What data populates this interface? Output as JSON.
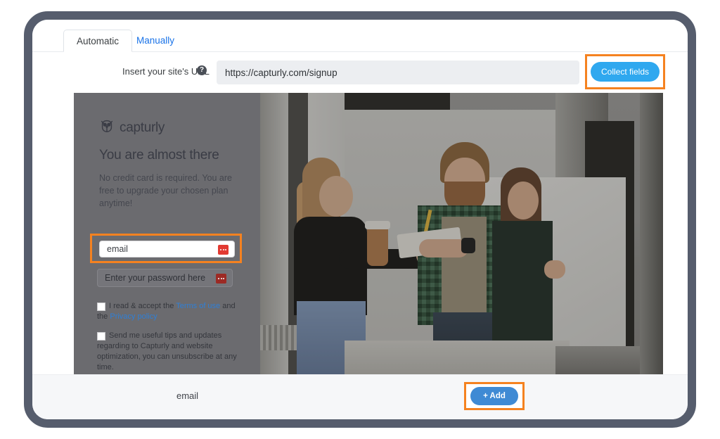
{
  "tabs": [
    {
      "label": "Automatic",
      "active": true
    },
    {
      "label": "Manually",
      "active": false
    }
  ],
  "url_row": {
    "label": "Insert your site's URL",
    "help_icon": "question-mark-icon",
    "url_value": "https://capturly.com/signup",
    "url_placeholder": "https://",
    "collect_button": "Collect fields"
  },
  "preview": {
    "brand": {
      "icon": "owl-icon",
      "name": "capturly"
    },
    "headline": "You are almost there",
    "subtext": "No credit card is required. You are free to upgrade your chosen plan anytime!",
    "email_field": {
      "value": "email",
      "badge_icon": "ellipsis-icon"
    },
    "password_field": {
      "value": "Enter your password here",
      "badge_icon": "ellipsis-icon"
    },
    "checkboxes": [
      {
        "text_before": "I read & accept the ",
        "link1": "Terms of use",
        "text_middle": " and the ",
        "link2": "Privacy policy",
        "text_after": ""
      },
      {
        "text_before": "Send me useful tips and updates regarding to Capturly and website optimization, you can unsubscribe at any time.",
        "link1": "",
        "text_middle": "",
        "link2": "",
        "text_after": ""
      }
    ]
  },
  "footer": {
    "field_label": "email",
    "add_button": "+ Add"
  },
  "colors": {
    "frame": "#565d6d",
    "accent_blue": "#2fa8ef",
    "add_blue": "#3f8ad4",
    "highlight_orange": "#f58220",
    "link_blue": "#1a73e8",
    "badge_red": "#e23a32",
    "overlay_grey": "#6b6b6f"
  }
}
